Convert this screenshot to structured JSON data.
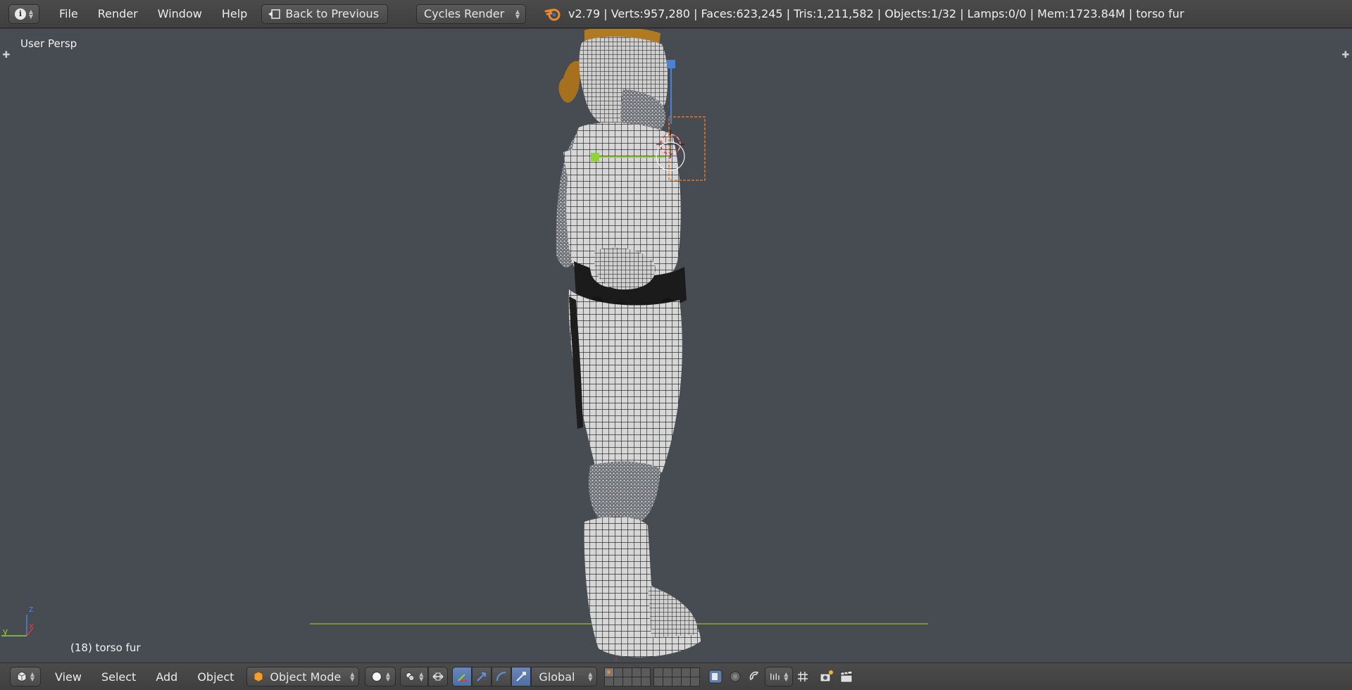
{
  "top_header": {
    "editor_icon": "info-icon",
    "menus": [
      "File",
      "Render",
      "Window",
      "Help"
    ],
    "back_button": "Back to Previous",
    "render_engine": "Cycles Render",
    "stats": "v2.79 | Verts:957,280 | Faces:623,245 | Tris:1,211,582 | Objects:1/32 | Lamps:0/0 | Mem:1723.84M | torso fur"
  },
  "viewport": {
    "view_label": "User Persp",
    "object_info": "(18) torso fur",
    "axis": {
      "x": "x",
      "y": "y",
      "z": "z"
    },
    "colors": {
      "background": "#474c53",
      "grid_line": "#8aa43c",
      "hair": "#b07a22",
      "selection": "#e07a2a"
    }
  },
  "bottom_header": {
    "editor_icon": "cube-icon",
    "menus": [
      "View",
      "Select",
      "Add",
      "Object"
    ],
    "mode": "Object Mode",
    "transform_orientation": "Global"
  }
}
